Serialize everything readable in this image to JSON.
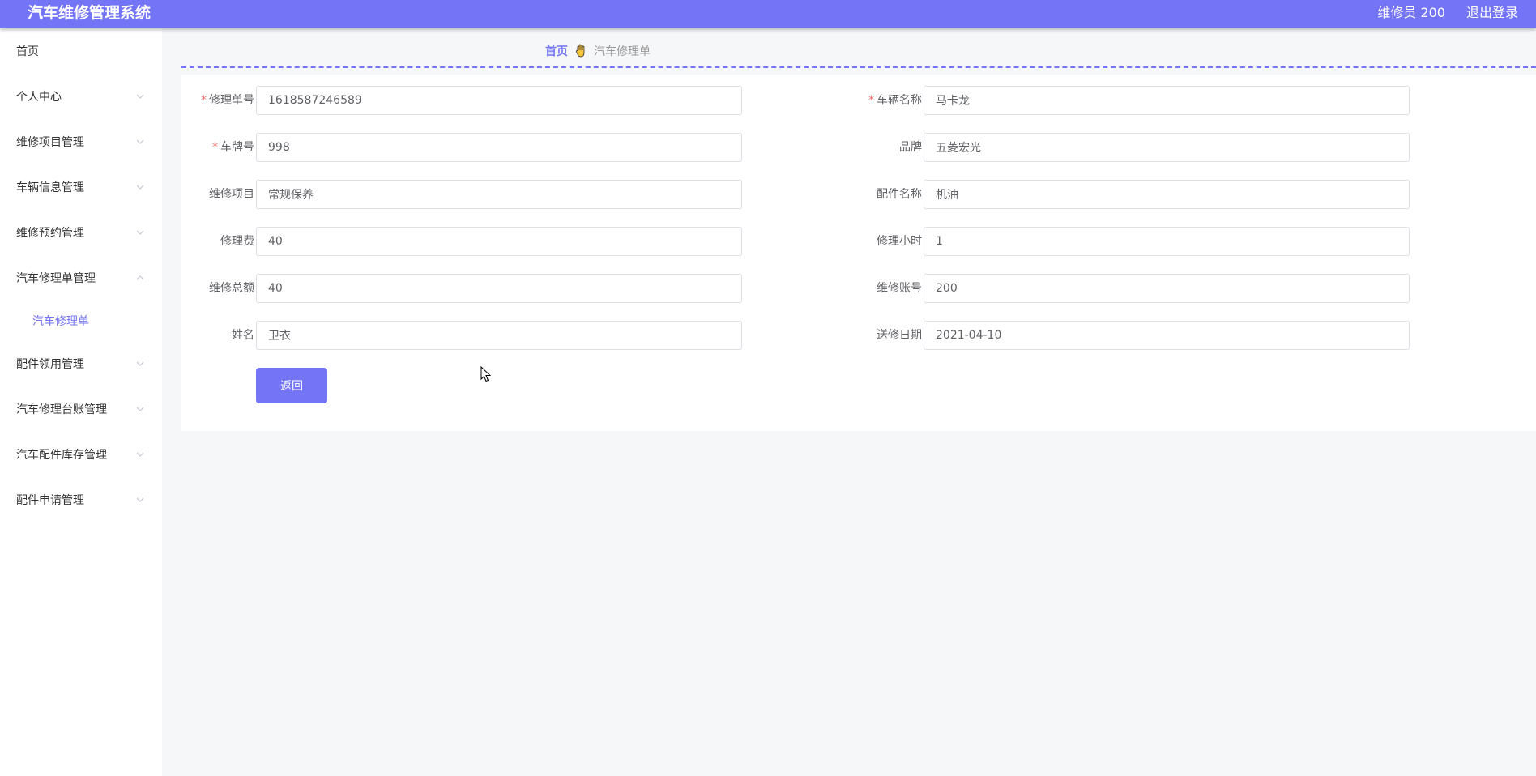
{
  "header": {
    "title": "汽车维修管理系统",
    "user": "维修员 200",
    "logout": "退出登录"
  },
  "sidebar": {
    "items": [
      {
        "label": "首页",
        "has_chevron": false
      },
      {
        "label": "个人中心",
        "has_chevron": true
      },
      {
        "label": "维修项目管理",
        "has_chevron": true
      },
      {
        "label": "车辆信息管理",
        "has_chevron": true
      },
      {
        "label": "维修预约管理",
        "has_chevron": true
      },
      {
        "label": "汽车修理单管理",
        "has_chevron": true,
        "expanded": true
      },
      {
        "label": "配件领用管理",
        "has_chevron": true
      },
      {
        "label": "汽车修理台账管理",
        "has_chevron": true
      },
      {
        "label": "汽车配件库存管理",
        "has_chevron": true
      },
      {
        "label": "配件申请管理",
        "has_chevron": true
      }
    ],
    "submenu": {
      "label": "汽车修理单",
      "active": true
    }
  },
  "breadcrumb": {
    "home": "首页",
    "current": "汽车修理单"
  },
  "form": {
    "fields": [
      {
        "label": "修理单号",
        "value": "1618587246589",
        "required": true
      },
      {
        "label": "车辆名称",
        "value": "马卡龙",
        "required": true
      },
      {
        "label": "车牌号",
        "value": "998",
        "required": true
      },
      {
        "label": "品牌",
        "value": "五菱宏光",
        "required": false
      },
      {
        "label": "维修项目",
        "value": "常规保养",
        "required": false
      },
      {
        "label": "配件名称",
        "value": "机油",
        "required": false
      },
      {
        "label": "修理费",
        "value": "40",
        "required": false
      },
      {
        "label": "修理小时",
        "value": "1",
        "required": false
      },
      {
        "label": "维修总额",
        "value": "40",
        "required": false
      },
      {
        "label": "维修账号",
        "value": "200",
        "required": false
      },
      {
        "label": "姓名",
        "value": "卫衣",
        "required": false
      },
      {
        "label": "送修日期",
        "value": "2021-04-10",
        "required": false
      }
    ],
    "back_button": "返回"
  },
  "colors": {
    "accent": "#7474f6",
    "required": "#f56c6c",
    "background": "#f6f7f9"
  }
}
